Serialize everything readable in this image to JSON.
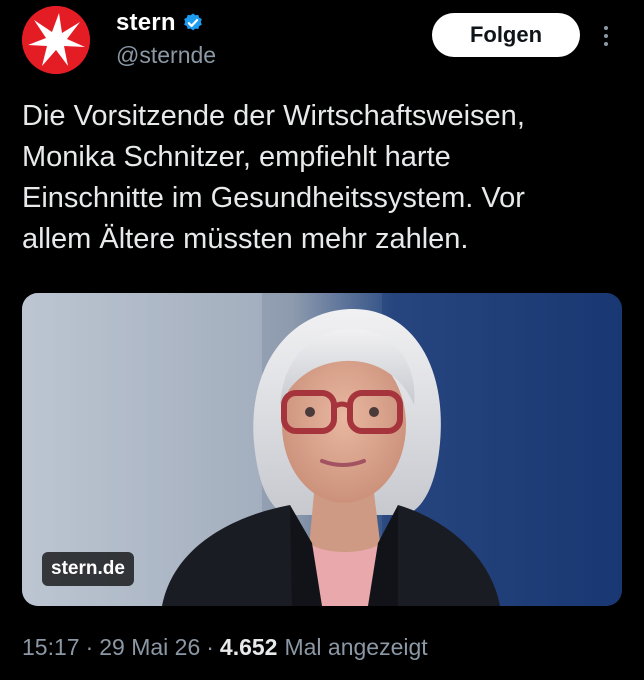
{
  "author": {
    "display_name": "stern",
    "handle": "@sternde",
    "avatar_icon": "stern-star-logo",
    "avatar_color": "#e41c24",
    "verified_icon": "verified-badge-icon",
    "verified_color": "#1d9bf0"
  },
  "follow_button": {
    "label": "Folgen"
  },
  "more_menu": {
    "icon": "more-vertical-icon"
  },
  "tweet": {
    "text": "Die Vorsitzende der Wirtschaftsweisen,\nMonika Schnitzer, empfiehlt harte\nEinschnitte im Gesundheitssystem. Vor\nallem Ältere müssten mehr zahlen."
  },
  "media": {
    "link_domain": "stern.de"
  },
  "meta": {
    "time": "15:17",
    "separator": "·",
    "date": "29 Mai 26",
    "views_count": "4.652",
    "views_label": "Mal angezeigt"
  },
  "colors": {
    "background": "#000000",
    "primary_text": "#e7e9ea",
    "secondary_text": "#8b98a5"
  }
}
